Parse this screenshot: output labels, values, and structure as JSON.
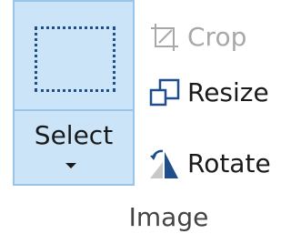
{
  "select": {
    "label": "Select"
  },
  "tools": {
    "crop": {
      "label": "Crop",
      "enabled": false
    },
    "resize": {
      "label": "Resize",
      "enabled": true
    },
    "rotate": {
      "label": "Rotate",
      "enabled": true
    }
  },
  "group": {
    "label": "Image"
  },
  "colors": {
    "selected_fill": "#cce4f7",
    "selected_border": "#98c4ea",
    "icon_blue": "#1f4e8c",
    "disabled_text": "#a8a8a8"
  }
}
